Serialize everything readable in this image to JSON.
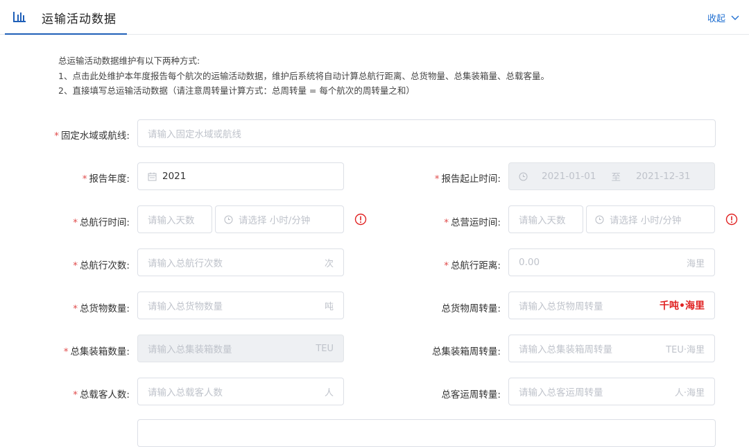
{
  "header": {
    "title": "运输活动数据",
    "collapse_label": "收起"
  },
  "notes": [
    "总运输活动数据维护有以下两种方式:",
    "1、点击此处维护本年度报告每个航次的运输活动数据，维护后系统将自动计算总航行距离、总货物量、总集装箱量、总载客量。",
    "2、直接填写总运输活动数据（请注意周转量计算方式：总周转量 = 每个航次的周转量之和）"
  ],
  "form": {
    "fixed_waters": {
      "label": "固定水域或航线:",
      "placeholder": "请输入固定水域或航线"
    },
    "report_year": {
      "label": "报告年度:",
      "value": "2021"
    },
    "report_period": {
      "label": "报告起止时间:",
      "start": "2021-01-01",
      "sep": "至",
      "end": "2021-12-31"
    },
    "sail_time": {
      "label": "总航行时间:",
      "days_placeholder": "请输入天数",
      "time_placeholder": "请选择 小时/分钟"
    },
    "operate_time": {
      "label": "总营运时间:",
      "days_placeholder": "请输入天数",
      "time_placeholder": "请选择 小时/分钟"
    },
    "sail_count": {
      "label": "总航行次数:",
      "placeholder": "请输入总航行次数",
      "unit": "次"
    },
    "sail_distance": {
      "label": "总航行距离:",
      "value": "0.00",
      "unit": "海里"
    },
    "cargo_qty": {
      "label": "总货物数量:",
      "placeholder": "请输入总货物数量",
      "unit": "吨"
    },
    "cargo_turnover": {
      "label": "总货物周转量:",
      "placeholder": "请输入总货物周转量",
      "unit": "千吨•海里"
    },
    "container_qty": {
      "label": "总集装箱数量:",
      "placeholder": "请输入总集装箱数量",
      "unit": "TEU"
    },
    "container_turnover": {
      "label": "总集装箱周转量:",
      "placeholder": "请输入总集装箱周转量",
      "unit": "TEU·海里"
    },
    "passenger_qty": {
      "label": "总载客人数:",
      "placeholder": "请输入总载客人数",
      "unit": "人"
    },
    "passenger_turnover": {
      "label": "总客运周转量:",
      "placeholder": "请输入总客运周转量",
      "unit": "人·海里"
    }
  },
  "colors": {
    "accent": "#1f5fb8",
    "link": "#1f6fd1",
    "required": "#e04b4b",
    "warning": "#e02222"
  }
}
